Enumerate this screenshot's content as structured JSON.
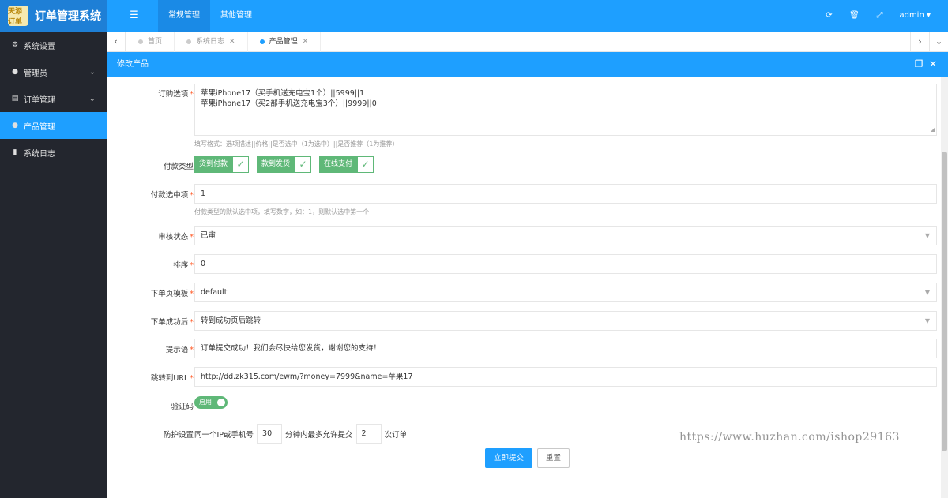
{
  "app": {
    "logo_text": "天添订单",
    "title": "订单管理系统"
  },
  "header": {
    "menu_icon": "menu-icon",
    "nav": [
      {
        "label": "常规管理"
      },
      {
        "label": "其他管理"
      }
    ],
    "user": "admin ▾"
  },
  "sidebar": {
    "items": [
      {
        "label": "系统设置",
        "icon": "gears-icon"
      },
      {
        "label": "管理员",
        "icon": "user-icon"
      },
      {
        "label": "订单管理",
        "icon": "list-icon"
      },
      {
        "label": "产品管理",
        "icon": "product-icon"
      },
      {
        "label": "系统日志",
        "icon": "file-icon"
      }
    ]
  },
  "tabs": [
    {
      "label": "首页"
    },
    {
      "label": "系统日志"
    },
    {
      "label": "产品管理"
    }
  ],
  "panel": {
    "title": "修改产品"
  },
  "form": {
    "options_label": "订购选项",
    "options_lines": [
      "苹果iPhone17（买手机送充电宝1个）||5999||1",
      "苹果iPhone17（买2部手机送充电宝3个）||9999||0"
    ],
    "options_hint": "填写格式：选项描述||价格||是否选中（1为选中）||是否推荐（1为推荐）",
    "pay_type_label": "付款类型",
    "pay_types": [
      {
        "label": "货到付款"
      },
      {
        "label": "款到发货"
      },
      {
        "label": "在线支付"
      }
    ],
    "pay_default_label": "付款选中项",
    "pay_default_value": "1",
    "pay_default_hint": "付款类型的默认选中项，填写数字，如：1，则默认选中第一个",
    "audit_label": "审核状态",
    "audit_value": "已审",
    "sort_label": "排序",
    "sort_value": "0",
    "template_label": "下单页模板",
    "template_value": "default",
    "after_order_label": "下单成功后",
    "after_order_value": "转到成功页后跳转",
    "tip_label": "提示语",
    "tip_value": "订单提交成功！我们会尽快给您发货，谢谢您的支持！",
    "redirect_label": "跳转到URL",
    "redirect_value": "http://dd.zk315.com/ewm/?money=7999&name=苹果17",
    "captcha_label": "验证码",
    "captcha_switch": "启用",
    "protect_label": "防护设置",
    "protect_text1": "同一个IP或手机号",
    "protect_minutes": "30",
    "protect_text2": "分钟内最多允许提交",
    "protect_count": "2",
    "protect_text3": "次订单",
    "submit_label": "立即提交",
    "reset_label": "重置"
  },
  "watermark": "https://www.huzhan.com/ishop29163"
}
